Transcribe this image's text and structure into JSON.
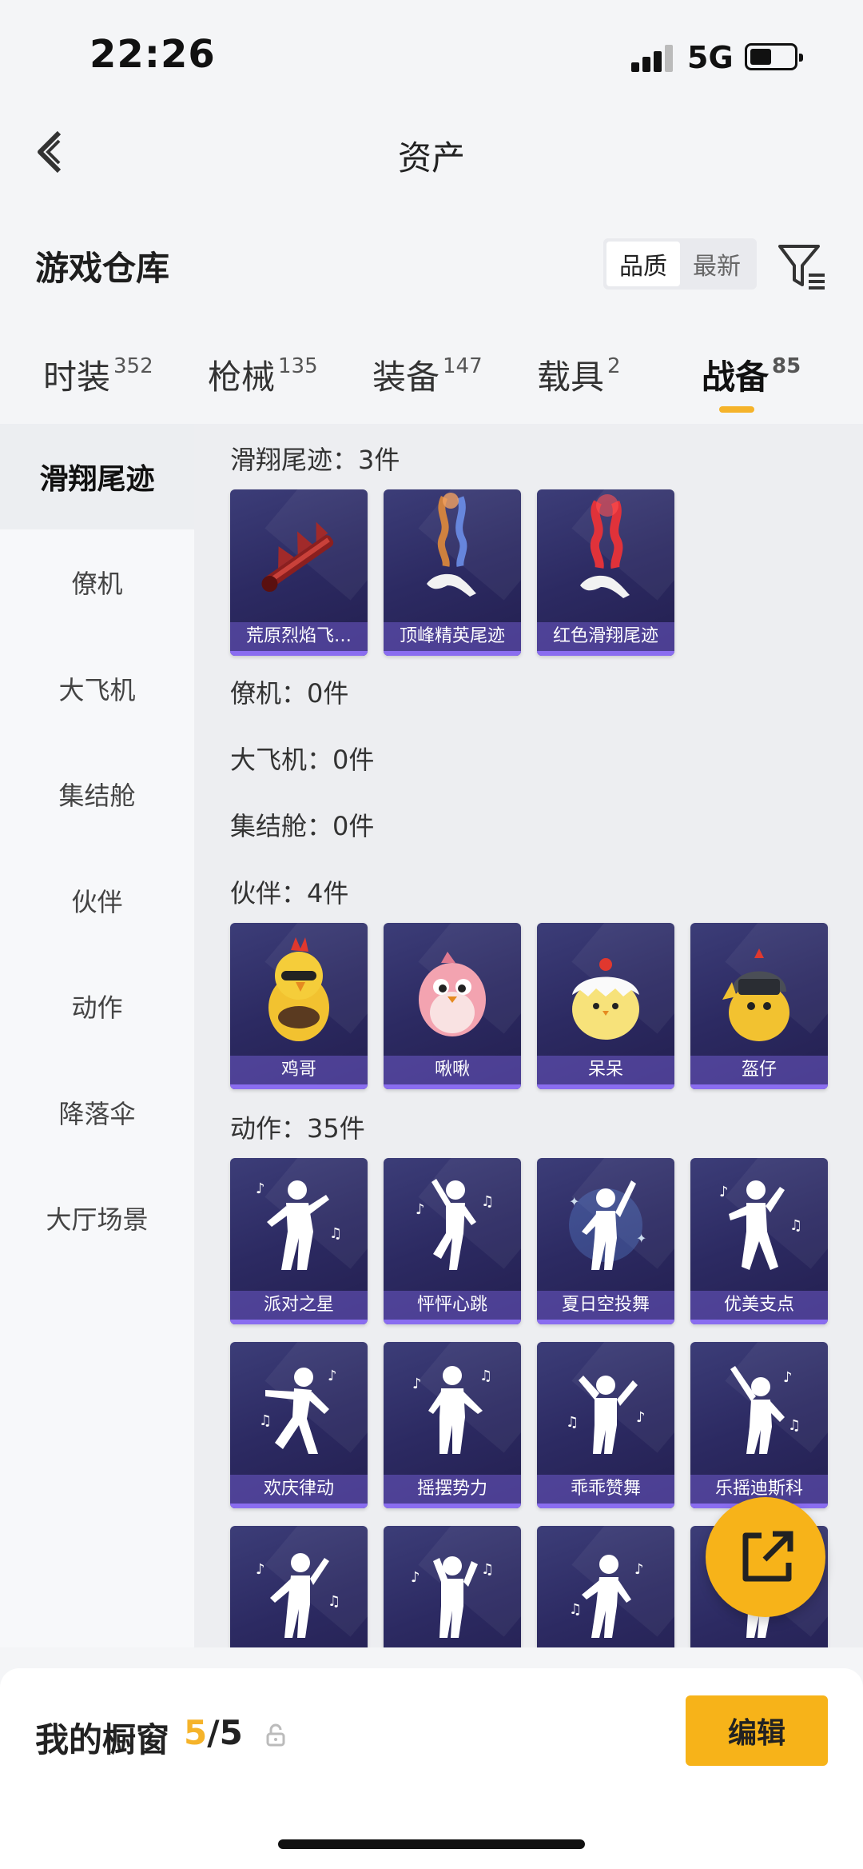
{
  "status": {
    "time": "22:26",
    "network": "5G"
  },
  "nav": {
    "title": "资产"
  },
  "section": {
    "title": "游戏仓库",
    "sort_options": [
      "品质",
      "最新"
    ],
    "active_sort": "品质"
  },
  "tabs": [
    {
      "label": "时装",
      "count": "352"
    },
    {
      "label": "枪械",
      "count": "135"
    },
    {
      "label": "装备",
      "count": "147"
    },
    {
      "label": "载具",
      "count": "2"
    },
    {
      "label": "战备",
      "count": "85",
      "active": true
    }
  ],
  "sidebar": {
    "items": [
      "滑翔尾迹",
      "僚机",
      "大飞机",
      "集结舱",
      "伙伴",
      "动作",
      "降落伞",
      "大厅场景"
    ],
    "active": "滑翔尾迹"
  },
  "groups": {
    "trail": {
      "title": "滑翔尾迹：3件",
      "items": [
        "荒原烈焰飞…",
        "顶峰精英尾迹",
        "红色滑翔尾迹"
      ]
    },
    "wingman": {
      "title": "僚机：0件"
    },
    "plane": {
      "title": "大飞机：0件"
    },
    "pod": {
      "title": "集结舱：0件"
    },
    "companion": {
      "title": "伙伴：4件",
      "items": [
        "鸡哥",
        "啾啾",
        "呆呆",
        "盔仔"
      ]
    },
    "emote": {
      "title": "动作：35件",
      "items": [
        "派对之星",
        "怦怦心跳",
        "夏日空投舞",
        "优美支点",
        "欢庆律动",
        "摇摆势力",
        "乖乖赞舞",
        "乐摇迪斯科",
        "",
        "",
        "",
        ""
      ]
    }
  },
  "bottom": {
    "showcase_label": "我的橱窗",
    "current": "5",
    "total": "/5",
    "edit_label": "编辑"
  },
  "colors": {
    "accent": "#f7b319",
    "card_bg": "#2c2a62",
    "label_bg": "#6e5ac8"
  },
  "icons": [
    "back-icon",
    "filter-icon",
    "share-icon",
    "lock-icon",
    "signal-icon",
    "battery-icon"
  ]
}
